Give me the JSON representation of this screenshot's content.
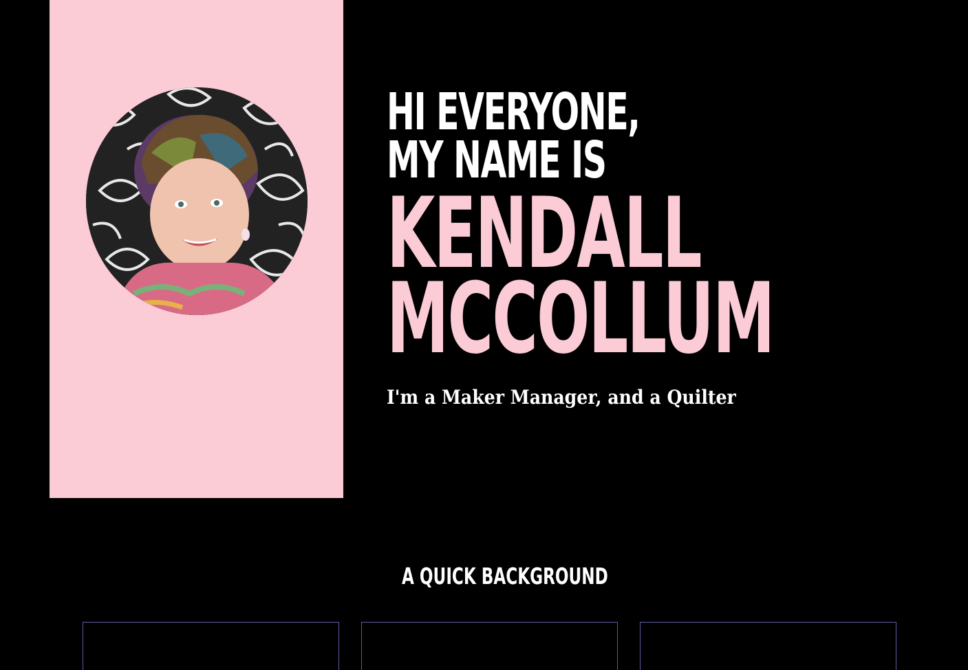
{
  "hero": {
    "greeting_line1": "HI EVERYONE,",
    "greeting_line2": "MY NAME IS",
    "name_line1": "KENDALL",
    "name_line2": "MCCOLLUM",
    "tagline": "I'm a Maker Manager, and a Quilter"
  },
  "background_section": {
    "title": "A QUICK BACKGROUND",
    "cards": [
      "",
      "",
      ""
    ]
  },
  "colors": {
    "page_bg": "#000000",
    "accent_pink": "#fbcbd6",
    "text_white": "#ffffff",
    "card_border": "#5a5aa8"
  }
}
